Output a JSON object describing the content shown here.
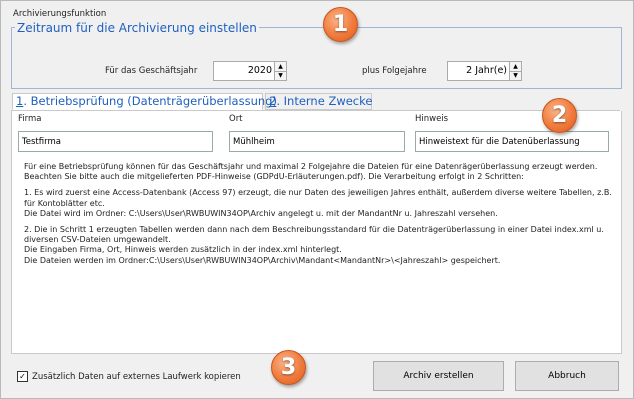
{
  "window": {
    "title": "Archivierungsfunktion"
  },
  "period_group": {
    "legend": "Zeitraum für die Archivierung einstellen",
    "year_label": "Für das Geschäftsjahr",
    "year_value": "2020",
    "followup_label": "plus Folgejahre",
    "followup_value": "2 Jahr(e)"
  },
  "tabs": [
    {
      "number": "1",
      "label": ". Betriebsprüfung (Datenträgerüberlassung)"
    },
    {
      "number": "2",
      "label": ". Interne Zwecke"
    }
  ],
  "fields": {
    "firma_label": "Firma",
    "firma_value": "Testfirma",
    "ort_label": "Ort",
    "ort_value": "Mühlheim",
    "hinweis_label": "Hinweis",
    "hinweis_value": "Hinweistext für die Datenüberlassung"
  },
  "description": [
    "Für eine Betriebsprüfung können für das Geschäftsjahr und maximal 2 Folgejahre die Dateien für eine Datenrägerüberlassung erzeugt werden. Beachten Sie bitte auch die mitgelieferten PDF-Hinweise (GDPdU-Erläuterungen.pdf). Die Verarbeitung erfolgt in 2 Schritten:",
    "1. Es wird zuerst eine Access-Datenbank (Access 97) erzeugt, die nur Daten des jeweiligen Jahres enthält, außerdem diverse weitere Tabellen, z.B. für Kontoblätter etc.\nDie Datei wird im Ordner: C:\\Users\\User\\RWBUWIN34OP\\Archiv angelegt u. mit der MandantNr u. Jahreszahl versehen.",
    "2. Die in Schritt 1 erzeugten Tabellen werden dann nach dem Beschreibungsstandard für die Datenträgerüberlassung in einer Datei index.xml u. diversen CSV-Dateien umgewandelt.\nDie Eingaben Firma, Ort, Hinweis werden zusätzlich in der index.xml hinterlegt.\nDie Dateien werden im Ordner:C:\\Users\\User\\RWBUWIN34OP\\Archiv\\Mandant<MandantNr>\\<Jahreszahl> gespeichert."
  ],
  "footer": {
    "checkbox_label": "Zusätzlich Daten auf externes Laufwerk kopieren",
    "checkbox_checked": true,
    "create_button": "Archiv erstellen",
    "cancel_button": "Abbruch"
  },
  "badges": [
    "1",
    "2",
    "3"
  ],
  "colors": {
    "accent": "#1f5fbf",
    "badge": "#f07b3d"
  }
}
